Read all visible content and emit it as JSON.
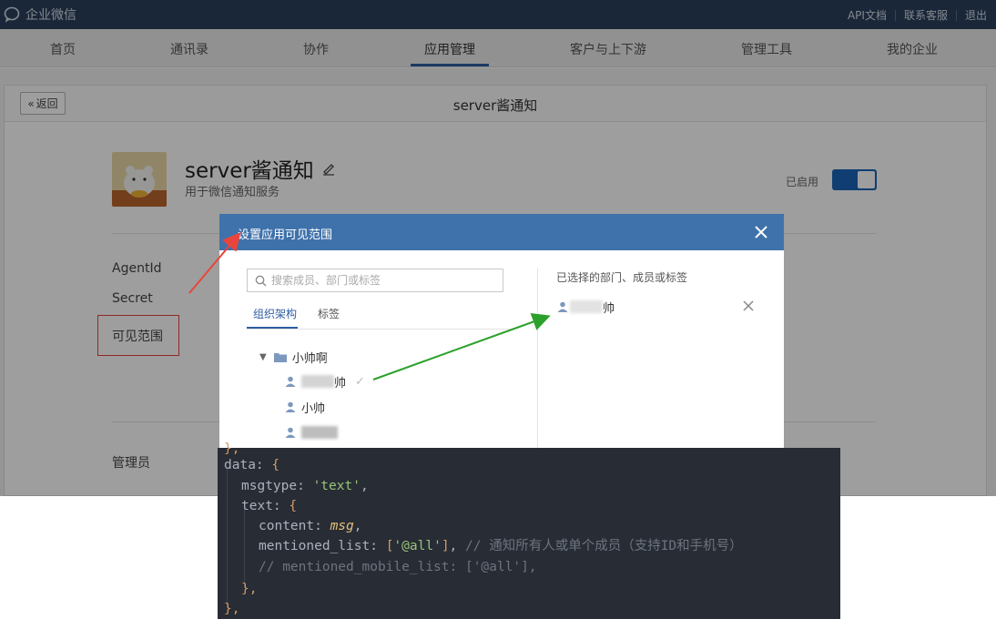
{
  "topbar": {
    "logo_text": "企业微信",
    "links": [
      "API文档",
      "联系客服",
      "退出"
    ]
  },
  "nav": {
    "items": [
      "首页",
      "通讯录",
      "协作",
      "应用管理",
      "客户与上下游",
      "管理工具",
      "我的企业"
    ],
    "active_index": 3
  },
  "page": {
    "back_label": "返回",
    "title": "server酱通知"
  },
  "app": {
    "name": "server酱通知",
    "description": "用于微信通知服务",
    "status_label": "已启用",
    "enabled": true
  },
  "fields": {
    "agent_id": "AgentId",
    "secret": "Secret",
    "visible_scope": "可见范围",
    "admin": "管理员"
  },
  "modal": {
    "title": "设置应用可见范围",
    "search_placeholder": "搜索成员、部门或标签",
    "tabs": [
      "组织架构",
      "标签"
    ],
    "tree": {
      "department": "小帅啊",
      "member_1_suffix": "帅",
      "member_2": "小帅"
    },
    "selected_title": "已选择的部门、成员或标签",
    "selected_item_suffix": "帅"
  },
  "colors": {
    "topbar": "#2a3f5d",
    "accent": "#2d5ea4",
    "modal_header": "#3f72ab",
    "highlight_red": "#e8453c",
    "arrow_green": "#2ba12b"
  },
  "code": {
    "lines": {
      "l0": "},",
      "l1_key": "data",
      "l2_key": "msgtype",
      "l2_val": "'text'",
      "l3_key": "text",
      "l4_key": "content",
      "l4_val": "msg",
      "l5_key": "mentioned_list",
      "l5_val": "'@all'",
      "l5_comment": "// 通知所有人或单个成员（支持ID和手机号）",
      "l6_comment": "// mentioned_mobile_list: ['@all'],",
      "l7": "},",
      "l8": "},"
    }
  }
}
